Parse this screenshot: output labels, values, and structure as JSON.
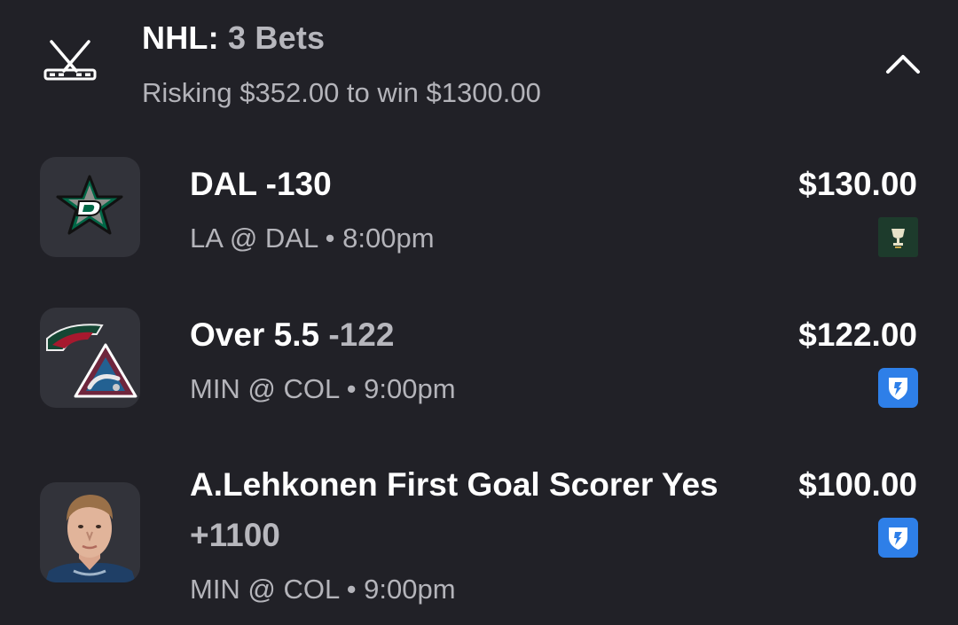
{
  "header": {
    "league": "NHL:",
    "count_text": "3 Bets",
    "summary": "Risking $352.00 to win $1300.00",
    "sport_icon": "hockey-sticks-icon",
    "toggle_icon": "chevron-up-icon"
  },
  "bets": [
    {
      "pick": "DAL",
      "odds": "-130",
      "matchup": "LA @ DAL • 8:00pm",
      "amount": "$130.00",
      "thumb": "dallas-stars-logo",
      "book_icon": "trophy-cup-icon"
    },
    {
      "pick": "Over 5.5",
      "odds": "-122",
      "matchup": "MIN @ COL • 9:00pm",
      "amount": "$122.00",
      "thumb": "wild-avalanche-logos",
      "book_icon": "fanduel-shield-icon"
    },
    {
      "pick": "A.Lehkonen First Goal Scorer Yes",
      "odds": "+1100",
      "matchup": "MIN @ COL • 9:00pm",
      "amount": "$100.00",
      "thumb": "player-headshot",
      "book_icon": "fanduel-shield-icon"
    }
  ],
  "colors": {
    "background": "#212127",
    "thumb_bg": "#32333a",
    "muted_text": "#b4b4ba",
    "fanduel_blue": "#2e7fe8",
    "stars_green": "#006847"
  }
}
